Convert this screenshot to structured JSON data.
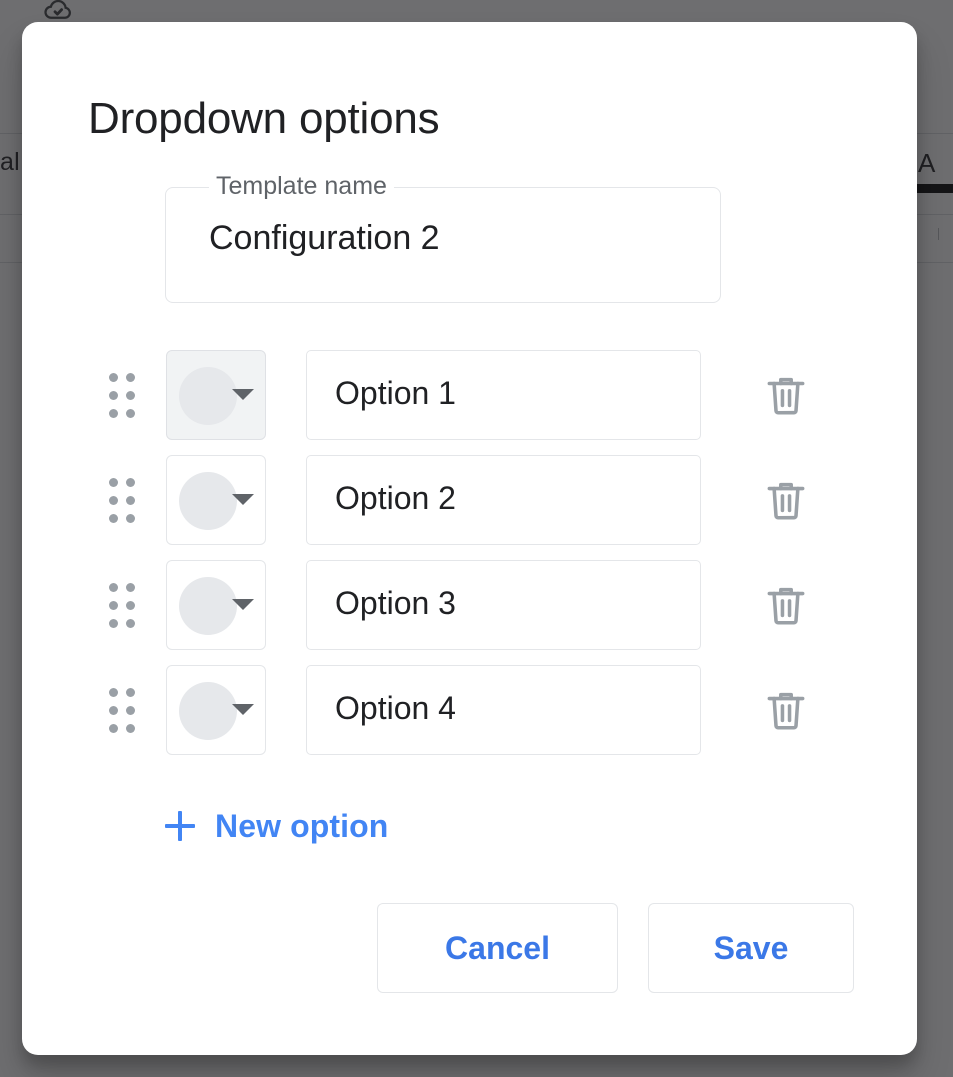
{
  "background": {
    "saved_icon": "cloud-done-icon",
    "menu_label_fragment": "al",
    "column_header": "A"
  },
  "dialog": {
    "title": "Dropdown options",
    "template_field": {
      "label": "Template name",
      "value": "Configuration 2"
    },
    "options": [
      {
        "drag_handle_icon": "drag-handle-icon",
        "color": "#e6e8eb",
        "caret_icon": "chevron-down-icon",
        "value": "Option 1",
        "delete_icon": "trash-icon",
        "color_button_active": true
      },
      {
        "drag_handle_icon": "drag-handle-icon",
        "color": "#e6e8eb",
        "caret_icon": "chevron-down-icon",
        "value": "Option 2",
        "delete_icon": "trash-icon",
        "color_button_active": false
      },
      {
        "drag_handle_icon": "drag-handle-icon",
        "color": "#e6e8eb",
        "caret_icon": "chevron-down-icon",
        "value": "Option 3",
        "delete_icon": "trash-icon",
        "color_button_active": false
      },
      {
        "drag_handle_icon": "drag-handle-icon",
        "color": "#e6e8eb",
        "caret_icon": "chevron-down-icon",
        "value": "Option 4",
        "delete_icon": "trash-icon",
        "color_button_active": false
      }
    ],
    "new_option": {
      "icon": "plus-icon",
      "label": "New option"
    },
    "cancel_label": "Cancel",
    "save_label": "Save"
  },
  "colors": {
    "accent_blue": "#3b78e7",
    "link_blue": "#4285f4",
    "text_primary": "#202124",
    "text_secondary": "#5f6368",
    "border": "#e4e6e9",
    "swatch_gray": "#e6e8eb",
    "scrim": "rgba(32,33,36,0.65)"
  }
}
